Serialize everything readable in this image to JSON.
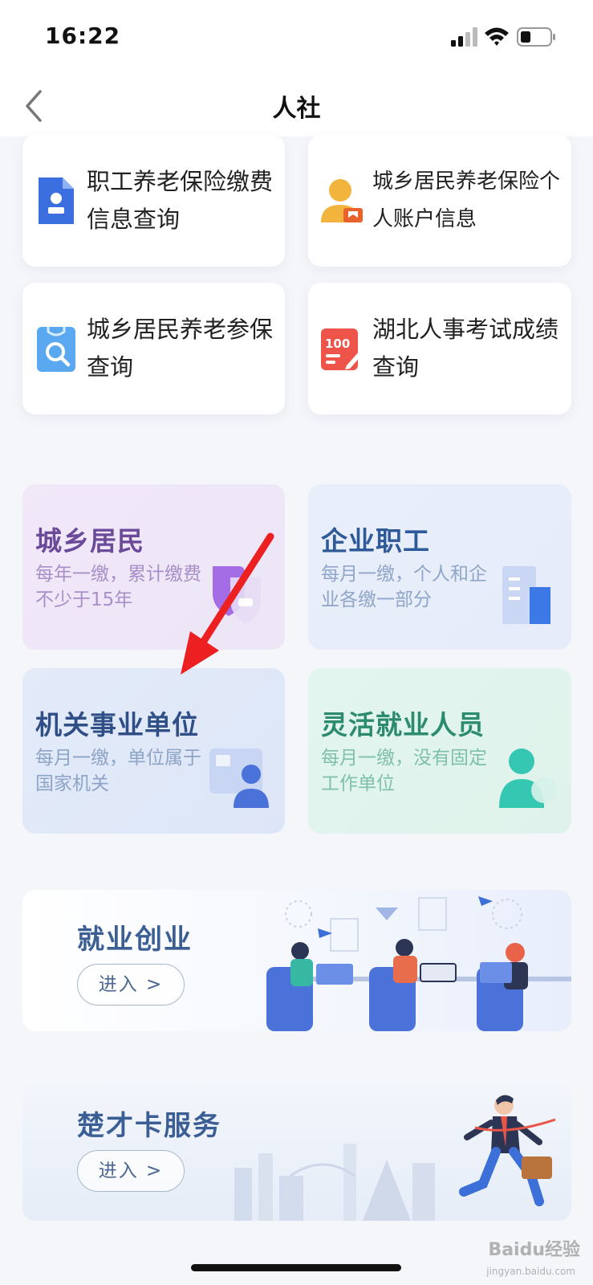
{
  "status": {
    "time": "16:22"
  },
  "nav": {
    "title": "人社"
  },
  "tiles": [
    {
      "label": "职工养老保险缴费信息查询",
      "icon": "document-person-icon"
    },
    {
      "label": "城乡居民养老保险个人账户信息",
      "icon": "person-card-icon"
    },
    {
      "label": "城乡居民养老参保查询",
      "icon": "badge-search-icon"
    },
    {
      "label": "湖北人事考试成绩查询",
      "icon": "score-100-icon"
    }
  ],
  "categories": [
    {
      "title": "城乡居民",
      "desc": "每年一缴，累计缴费不少于15年",
      "title_color": "#6b4a9a",
      "desc_color": "#a98fc8",
      "icon": "shield-icon"
    },
    {
      "title": "企业职工",
      "desc": "每月一缴，个人和企业各缴一部分",
      "title_color": "#2f5a99",
      "desc_color": "#8fa6c9",
      "icon": "building-icon"
    },
    {
      "title": "机关事业单位",
      "desc": "每月一缴，单位属于国家机关",
      "title_color": "#2f4f86",
      "desc_color": "#8ea4c6",
      "icon": "office-person-icon"
    },
    {
      "title": "灵活就业人员",
      "desc": "每月一缴，没有固定工作单位",
      "title_color": "#2c8a6e",
      "desc_color": "#7fc0aa",
      "icon": "person-icon"
    }
  ],
  "banners": [
    {
      "title": "就业创业",
      "enter": "进入 >"
    },
    {
      "title": "楚才卡服务",
      "enter": "进入 >"
    }
  ],
  "watermark": {
    "brand": "Baidu经验",
    "site": "jingyan.baidu.com"
  }
}
